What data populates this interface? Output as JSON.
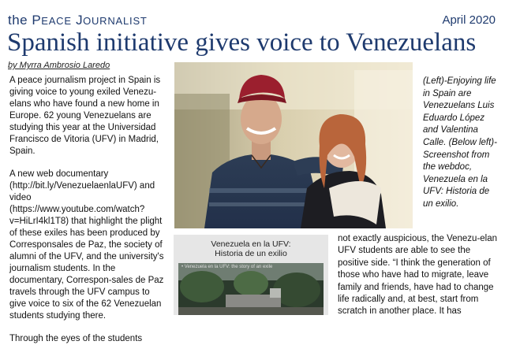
{
  "masthead": {
    "the": "the",
    "peace": "P",
    "peace_rest": "EACE",
    "journalist": "J",
    "journalist_rest": "OURNALIST"
  },
  "date": "April 2020",
  "headline": "Spanish initiative gives voice to Venezuelans",
  "byline": "by Myrra Ambrosio Laredo",
  "column1": {
    "p1": "A peace journalism project in Spain is giving voice to young exiled Venezu-elans who have found a new home in Europe.  62 young Venezuelans are studying this year at the Universidad Francisco de Vitoria (UFV) in Madrid, Spain.",
    "p2": "A new web documentary  (http://bit.ly/VenezuelaenlaUFV) and video (https://www.youtube.com/watch?v=HiLrI4kl1T8)  that highlight the plight of these exiles has been produced by Corresponsales de Paz, the society of alumni of the UFV, and the university's journalism students. In the documentary,  Correspon-sales de Paz travels through the UFV campus to give voice to  six of the 62 Venezuelan students studying there.",
    "p3": "Through the eyes of the students"
  },
  "caption": "(Left)-Enjoying life in Spain are Venezuelans Luis Eduardo López and Valentina Calle. (Below left)-Screenshot from the webdoc, Venezuela en la UFV: Historia de un exilio.",
  "screenshot": {
    "title_line1": "Venezuela en la UFV:",
    "title_line2": "Historia de un exilio",
    "small_text": "• Venezuela en la UFV: the story of an exile"
  },
  "column2": "not exactly auspicious, the Venezu-elan UFV students are able to see the positive side. “I think the generation of those who have had to migrate, leave family and friends, have had to change life radically and, at best, start from scratch in another place. It has",
  "colors": {
    "brand": "#1e3a6e",
    "text": "#111111"
  }
}
